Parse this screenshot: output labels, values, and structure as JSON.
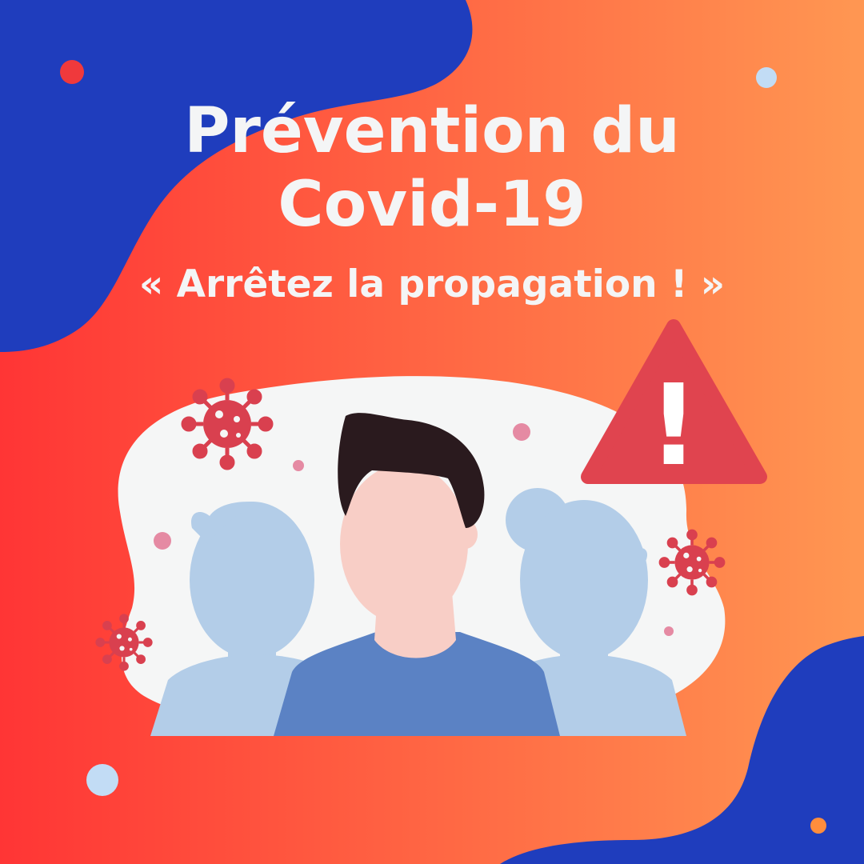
{
  "title": {
    "line1": "Prévention du",
    "line2": "Covid-19"
  },
  "subtitle": "« Arrêtez la propagation ! »",
  "warning_symbol": "!",
  "colors": {
    "gradient_start": "#ff3535",
    "gradient_end": "#ff9752",
    "blob_blue": "#1f3dbd",
    "cloud_white": "#f5f6f6",
    "warning_red": "#e0444f",
    "virus_red": "#d9404f",
    "silhouette_blue": "#b3cde8",
    "shirt_blue": "#5b82c4",
    "skin": "#f8cec6",
    "hair": "#2a1a1e",
    "dot_light_blue": "#c2dcf5",
    "dot_pink": "#e58aa3",
    "dot_red": "#f0393c",
    "dot_orange": "#ff8d3c"
  },
  "icons": [
    "warning-triangle-icon",
    "virus-icon",
    "person-icon"
  ]
}
